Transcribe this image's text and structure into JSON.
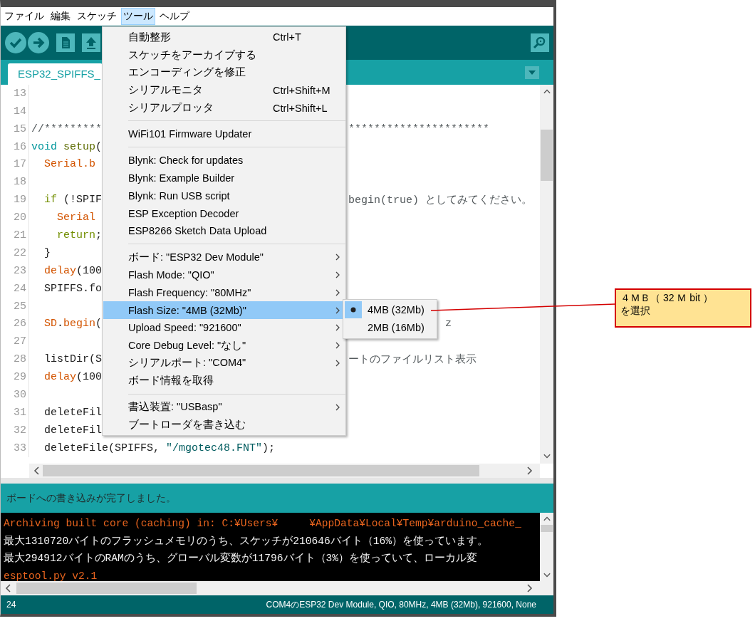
{
  "menu_bar": [
    {
      "label": "ファイル",
      "selected": false
    },
    {
      "label": "編集",
      "selected": false
    },
    {
      "label": "スケッチ",
      "selected": false
    },
    {
      "label": "ツール",
      "selected": true
    },
    {
      "label": "ヘルプ",
      "selected": false
    }
  ],
  "tab": {
    "label": "ESP32_SPIFFS_"
  },
  "editor": {
    "lines": [
      {
        "number": "13"
      },
      {
        "number": "14"
      },
      {
        "number": "15",
        "left": [
          {
            "text": "//*********",
            "kind": "comment"
          }
        ],
        "right": [
          {
            "text": "**********************",
            "kind": "comment"
          }
        ]
      },
      {
        "number": "16",
        "left": [
          {
            "text": "void",
            "kind": "type"
          },
          {
            "text": " setup",
            "kind": "function"
          },
          {
            "text": "(",
            "kind": "plain"
          }
        ]
      },
      {
        "number": "17",
        "left": [
          {
            "text": "  Serial.b",
            "kind": "builtin"
          }
        ]
      },
      {
        "number": "18"
      },
      {
        "number": "19",
        "left": [
          {
            "text": "  if",
            "kind": "keyword"
          },
          {
            "text": " (!SPIF",
            "kind": "plain"
          }
        ],
        "right": [
          {
            "text": "begin(true) としてみてください。",
            "kind": "comment"
          }
        ]
      },
      {
        "number": "20",
        "left": [
          {
            "text": "    Serial",
            "kind": "builtin"
          }
        ]
      },
      {
        "number": "21",
        "left": [
          {
            "text": "    return",
            "kind": "keyword"
          },
          {
            "text": ";",
            "kind": "plain"
          }
        ]
      },
      {
        "number": "22",
        "left": [
          {
            "text": "  }",
            "kind": "plain"
          }
        ]
      },
      {
        "number": "23",
        "left": [
          {
            "text": "  delay",
            "kind": "builtin"
          },
          {
            "text": "(100",
            "kind": "plain"
          }
        ]
      },
      {
        "number": "24",
        "left": [
          {
            "text": "  SPIFFS.fo",
            "kind": "plain"
          }
        ]
      },
      {
        "number": "25"
      },
      {
        "number": "26",
        "left": [
          {
            "text": "  SD",
            "kind": "builtin"
          },
          {
            "text": ".",
            "kind": "plain"
          },
          {
            "text": "begin",
            "kind": "builtin"
          },
          {
            "text": "(",
            "kind": "plain"
          }
        ],
        "right": [
          {
            "text": "z",
            "kind": "comment"
          }
        ]
      },
      {
        "number": "27"
      },
      {
        "number": "28",
        "left": [
          {
            "text": "  listDir(S",
            "kind": "plain"
          }
        ],
        "right": [
          {
            "text": "ートのファイルリスト表示",
            "kind": "comment"
          }
        ]
      },
      {
        "number": "29",
        "left": [
          {
            "text": "  delay",
            "kind": "builtin"
          },
          {
            "text": "(100",
            "kind": "plain"
          }
        ]
      },
      {
        "number": "30"
      },
      {
        "number": "31",
        "left": [
          {
            "text": "  deleteFil",
            "kind": "plain"
          }
        ]
      },
      {
        "number": "32",
        "left": [
          {
            "text": "  deleteFil",
            "kind": "plain"
          }
        ]
      },
      {
        "number": "33",
        "left": [
          {
            "text": "  deleteFile(SPIFFS, ",
            "kind": "plain"
          },
          {
            "text": "\"/mgotec48.FNT\"",
            "kind": "string"
          },
          {
            "text": ");",
            "kind": "plain"
          }
        ]
      }
    ]
  },
  "tools_menu": {
    "groups": [
      {
        "items": [
          {
            "label": "自動整形",
            "shortcut": "Ctrl+T",
            "has_submenu": false,
            "selected": false
          },
          {
            "label": "スケッチをアーカイブする",
            "has_submenu": false,
            "selected": false
          },
          {
            "label": "エンコーディングを修正",
            "has_submenu": false,
            "selected": false
          },
          {
            "label": "シリアルモニタ",
            "shortcut": "Ctrl+Shift+M",
            "has_submenu": false,
            "selected": false
          },
          {
            "label": "シリアルプロッタ",
            "shortcut": "Ctrl+Shift+L",
            "has_submenu": false,
            "selected": false
          }
        ]
      },
      {
        "items": [
          {
            "label": "WiFi101 Firmware Updater",
            "has_submenu": false,
            "selected": false
          }
        ]
      },
      {
        "items": [
          {
            "label": "Blynk: Check for updates",
            "has_submenu": false,
            "selected": false
          },
          {
            "label": "Blynk: Example Builder",
            "has_submenu": false,
            "selected": false
          },
          {
            "label": "Blynk: Run USB script",
            "has_submenu": false,
            "selected": false
          },
          {
            "label": "ESP Exception Decoder",
            "has_submenu": false,
            "selected": false
          },
          {
            "label": "ESP8266 Sketch Data Upload",
            "has_submenu": false,
            "selected": false
          }
        ]
      },
      {
        "items": [
          {
            "label": "ボード: \"ESP32 Dev Module\"",
            "has_submenu": true,
            "selected": false
          },
          {
            "label": "Flash Mode: \"QIO\"",
            "has_submenu": true,
            "selected": false
          },
          {
            "label": "Flash Frequency: \"80MHz\"",
            "has_submenu": true,
            "selected": false
          },
          {
            "label": "Flash Size: \"4MB (32Mb)\"",
            "has_submenu": true,
            "selected": true,
            "submenu": {
              "items": [
                {
                  "label": "4MB (32Mb)",
                  "checked": true
                },
                {
                  "label": "2MB (16Mb)",
                  "checked": false
                }
              ]
            }
          },
          {
            "label": "Upload Speed: \"921600\"",
            "has_submenu": true,
            "selected": false
          },
          {
            "label": "Core Debug Level: \"なし\"",
            "has_submenu": true,
            "selected": false
          },
          {
            "label": "シリアルポート: \"COM4\"",
            "has_submenu": true,
            "selected": false
          },
          {
            "label": "ボード情報を取得",
            "has_submenu": false,
            "selected": false
          }
        ]
      },
      {
        "items": [
          {
            "label": "書込装置: \"USBasp\"",
            "has_submenu": true,
            "selected": false
          },
          {
            "label": "ブートローダを書き込む",
            "has_submenu": false,
            "selected": false
          }
        ]
      }
    ]
  },
  "message": "ボードへの書き込みが完了しました。",
  "console": {
    "lines": [
      {
        "text": "Archiving built core (caching) in: C:¥Users¥     ¥AppData¥Local¥Temp¥arduino_cache_",
        "kind": "stderr"
      },
      {
        "text": "最大1310720バイトのフラッシュメモリのうち、スケッチが210646バイト（16%）を使っています。",
        "kind": "stdout"
      },
      {
        "text": "最大294912バイトのRAMのうち、グローバル変数が11796バイト（3%）を使っていて、ローカル変",
        "kind": "stdout"
      },
      {
        "text": "esptool.py v2.1",
        "kind": "stderr"
      }
    ]
  },
  "status_bar": {
    "line": "24",
    "board": "COM4のESP32 Dev Module, QIO, 80MHz, 4MB (32Mb), 921600, None"
  },
  "callout": {
    "lines": [
      "４ＭＢ（ 32 Ｍ bit ）",
      "を選択"
    ]
  }
}
